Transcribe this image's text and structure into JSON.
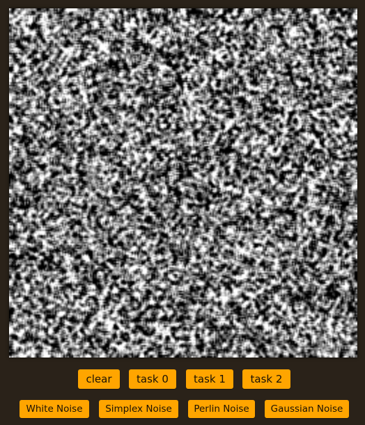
{
  "canvas": {
    "icon": "noise-texture"
  },
  "tasks": {
    "clear": "clear",
    "task0": "task 0",
    "task1": "task 1",
    "task2": "task 2"
  },
  "noise_types": {
    "white": "White Noise",
    "simplex": "Simplex Noise",
    "perlin": "Perlin Noise",
    "gaussian": "Gaussian Noise"
  },
  "colors": {
    "background": "#2a2219",
    "button": "#ffa500",
    "button_text": "#1a1206"
  }
}
